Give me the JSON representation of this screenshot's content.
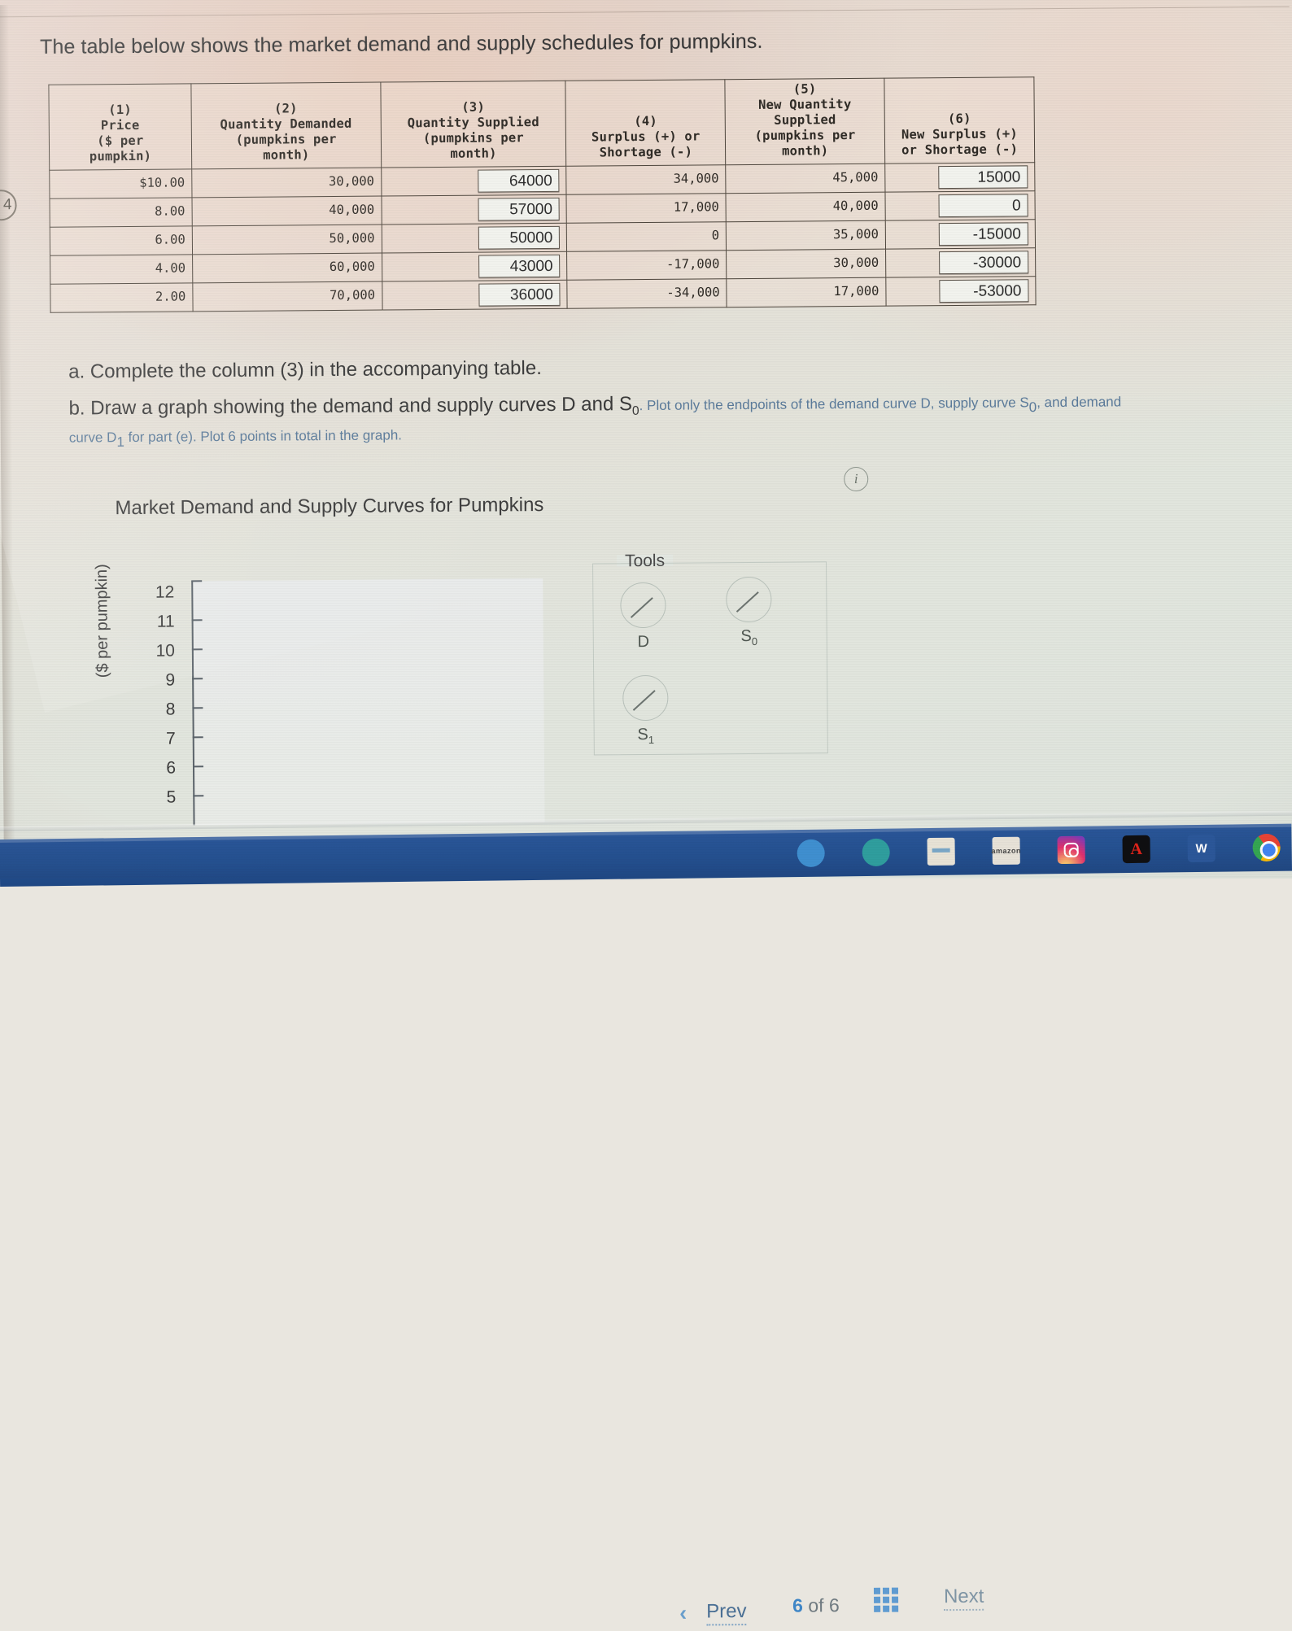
{
  "margin_mark": "4",
  "intro": "The table below shows the market demand and supply schedules for pumpkins.",
  "table": {
    "headers": [
      {
        "num": "(1)",
        "lines": [
          "Price",
          "($ per",
          "pumpkin)"
        ]
      },
      {
        "num": "(2)",
        "lines": [
          "Quantity Demanded",
          "(pumpkins per",
          "month)"
        ]
      },
      {
        "num": "(3)",
        "lines": [
          "Quantity Supplied",
          "(pumpkins per",
          "month)"
        ]
      },
      {
        "num": "(4)",
        "lines": [
          "Surplus (+) or",
          "Shortage (-)"
        ]
      },
      {
        "num": "(5)",
        "lines": [
          "New Quantity",
          "Supplied",
          "(pumpkins per",
          "month)"
        ]
      },
      {
        "num": "(6)",
        "lines": [
          "New Surplus (+)",
          "or Shortage (-)"
        ]
      }
    ],
    "rows": [
      {
        "price": "$10.00",
        "qd": "30,000",
        "qs": "64000",
        "surplus": "34,000",
        "new_qs": "45,000",
        "new_surplus": "15000"
      },
      {
        "price": "8.00",
        "qd": "40,000",
        "qs": "57000",
        "surplus": "17,000",
        "new_qs": "40,000",
        "new_surplus": "0"
      },
      {
        "price": "6.00",
        "qd": "50,000",
        "qs": "50000",
        "surplus": "0",
        "new_qs": "35,000",
        "new_surplus": "-15000"
      },
      {
        "price": "4.00",
        "qd": "60,000",
        "qs": "43000",
        "surplus": "-17,000",
        "new_qs": "30,000",
        "new_surplus": "-30000"
      },
      {
        "price": "2.00",
        "qd": "70,000",
        "qs": "36000",
        "surplus": "-34,000",
        "new_qs": "17,000",
        "new_surplus": "-53000"
      }
    ]
  },
  "prompts": {
    "a": "a. Complete the column (3) in the accompanying table.",
    "b_main_1": "b. Draw a graph showing the demand and supply curves D and S",
    "b_main_sub": "0",
    "b_sub_1": ". Plot only the endpoints of the demand curve D, supply curve S",
    "b_sub_sub1": "0",
    "b_sub_2": ", and demand",
    "b_line2_1": "curve D",
    "b_line2_sub": "1",
    "b_line2_2": " for part (e). Plot 6 points in total in the graph."
  },
  "info_icon": "i",
  "graph": {
    "title": "Market Demand and Supply Curves for Pumpkins",
    "ylabel": "($ per pumpkin)"
  },
  "tools": {
    "legend": "Tools",
    "items": [
      {
        "label": "D",
        "sub": ""
      },
      {
        "label": "S",
        "sub": "0"
      },
      {
        "label": "S",
        "sub": "1"
      }
    ]
  },
  "nav": {
    "prev": "Prev",
    "chevron": "‹",
    "current_page": "6",
    "of": "of",
    "total_pages": "6",
    "next": "Next"
  },
  "taskbar": {
    "amazon": "amazon",
    "word": "W",
    "acrobat": "A"
  },
  "chart_data": {
    "type": "line",
    "title": "Market Demand and Supply Curves for Pumpkins",
    "xlabel": "",
    "ylabel": "($ per pumpkin)",
    "ylim": [
      5,
      12
    ],
    "yticks": [
      12,
      11,
      10,
      9,
      8,
      7,
      6,
      5
    ],
    "grid": false,
    "legend_position": "right-panel",
    "series": [
      {
        "name": "D",
        "values": []
      },
      {
        "name": "S0",
        "values": []
      },
      {
        "name": "S1",
        "values": []
      }
    ],
    "note": "Empty plotting canvas - no points plotted yet"
  },
  "colors": {
    "accent_blue": "#4a6f94",
    "table_border": "#4e463d",
    "taskbar": "#2a5699"
  }
}
